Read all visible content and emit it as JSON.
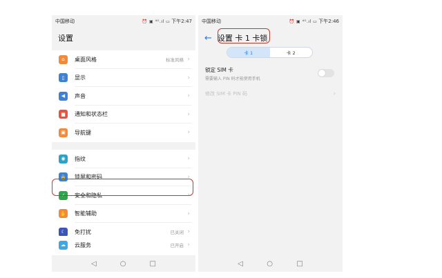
{
  "left_phone": {
    "status": {
      "carrier": "中国移动",
      "icons": "⏰ ▣ ⁴ᴳ.ıl ▭",
      "time": "下午2:47"
    },
    "title": "设置",
    "group1": [
      {
        "label": "桌面风格",
        "value": "标准风格",
        "icon": "home-icon",
        "color": "#f28a3a",
        "glyph": "⌂"
      },
      {
        "label": "显示",
        "value": "",
        "icon": "display-icon",
        "color": "#3b82d6",
        "glyph": "▯"
      },
      {
        "label": "声音",
        "value": "",
        "icon": "sound-icon",
        "color": "#3b82d6",
        "glyph": "◀"
      },
      {
        "label": "通知和状态栏",
        "value": "",
        "icon": "notification-icon",
        "color": "#e7533f",
        "glyph": "■"
      },
      {
        "label": "导航键",
        "value": "",
        "icon": "navigation-key-icon",
        "color": "#f28a3a",
        "glyph": "▣"
      }
    ],
    "group2": [
      {
        "label": "指纹",
        "value": "",
        "icon": "fingerprint-icon",
        "color": "#2ba3c9",
        "glyph": "◉"
      },
      {
        "label": "锁屏和密码",
        "value": "",
        "icon": "lock-icon",
        "color": "#3b82d6",
        "glyph": "🔒"
      },
      {
        "label": "安全和隐私",
        "value": "",
        "icon": "shield-icon",
        "color": "#2fa64a",
        "glyph": "✓"
      },
      {
        "label": "智能辅助",
        "value": "",
        "icon": "hand-icon",
        "color": "#f28a3a",
        "glyph": "✋"
      },
      {
        "label": "免打扰",
        "value": "已关闭",
        "icon": "moon-icon",
        "color": "#3a55b5",
        "glyph": "☾"
      }
    ],
    "group3": [
      {
        "label": "云服务",
        "value": "已开启",
        "icon": "cloud-icon",
        "color": "#3fa7e2",
        "glyph": "☁"
      }
    ],
    "chevron": "›"
  },
  "right_phone": {
    "status": {
      "carrier": "中国移动",
      "icons": "⏰ ▣ ⁴ᴳ.ıl ▭",
      "time": "下午2:46"
    },
    "back": "←",
    "title": "设置 卡 1 卡锁",
    "tabs": [
      "卡 1",
      "卡 2"
    ],
    "active_tab": 0,
    "lock_sim": {
      "title": "锁定 SIM 卡",
      "subtitle": "需要输入 PIN 码才能使用手机",
      "enabled": false
    },
    "change_pin": "修改 SIM 卡 PIN 码",
    "chevron": "›"
  },
  "nav": {
    "back": "◁",
    "home": "○",
    "recent": "□"
  },
  "highlight_color": "#c0392b"
}
